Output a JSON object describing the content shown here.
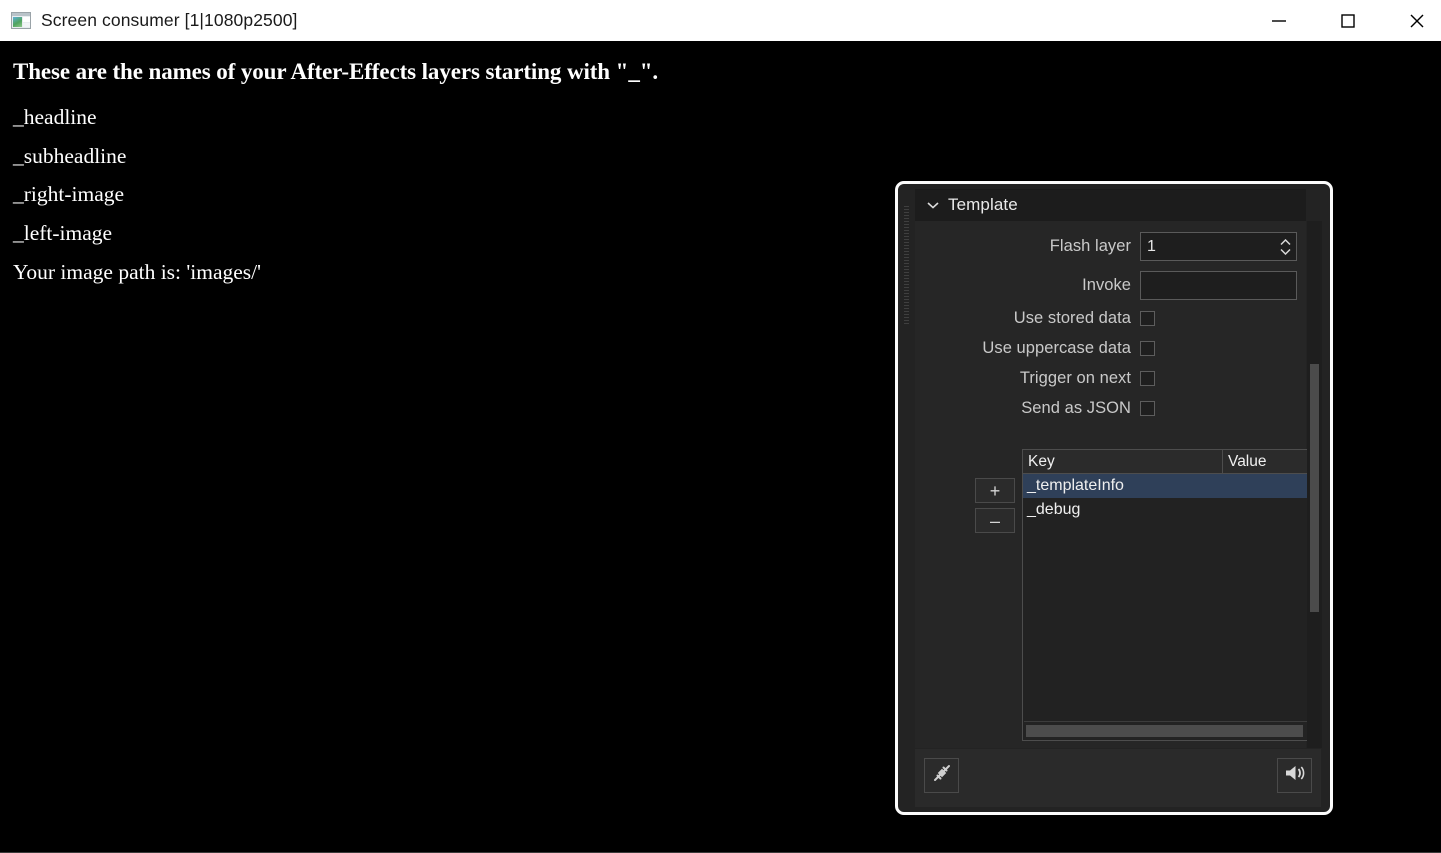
{
  "window": {
    "title": "Screen consumer [1|1080p2500]",
    "icon": "caspar-screen-icon",
    "controls": {
      "minimize": "minimize-icon",
      "maximize": "maximize-icon",
      "close": "close-icon"
    }
  },
  "canvas": {
    "heading": "These are the names of your After-Effects layers starting with \"_\".",
    "layers": [
      "_headline",
      "_subheadline",
      "_right-image",
      "_left-image"
    ],
    "image_path_line": "Your image path is: 'images/'"
  },
  "template_panel": {
    "title": "Template",
    "collapse_icon": "chevron-down-icon",
    "fields": {
      "flash_layer": {
        "label": "Flash layer",
        "value": "1",
        "placeholder": ""
      },
      "invoke": {
        "label": "Invoke",
        "value": "",
        "placeholder": ""
      }
    },
    "checkboxes": [
      {
        "label": "Use stored data",
        "checked": false
      },
      {
        "label": "Use uppercase data",
        "checked": false
      },
      {
        "label": "Trigger on next",
        "checked": false
      },
      {
        "label": "Send as JSON",
        "checked": false
      }
    ],
    "data_table": {
      "add_label": "+",
      "remove_label": "–",
      "columns": [
        "Key",
        "Value"
      ],
      "rows": [
        {
          "key": "_templateInfo",
          "value": "",
          "selected": true
        },
        {
          "key": "_debug",
          "value": "",
          "selected": false
        }
      ]
    },
    "footer": {
      "connect_icon": "plug-connect-icon",
      "volume_icon": "speaker-volume-icon"
    }
  },
  "colors": {
    "titlebar_bg": "#ffffff",
    "canvas_bg": "#000000",
    "panel_bg": "#232323",
    "panel_border": "#fcfcfc",
    "selection": "#2f4059",
    "label_text": "#c9c9c9"
  }
}
